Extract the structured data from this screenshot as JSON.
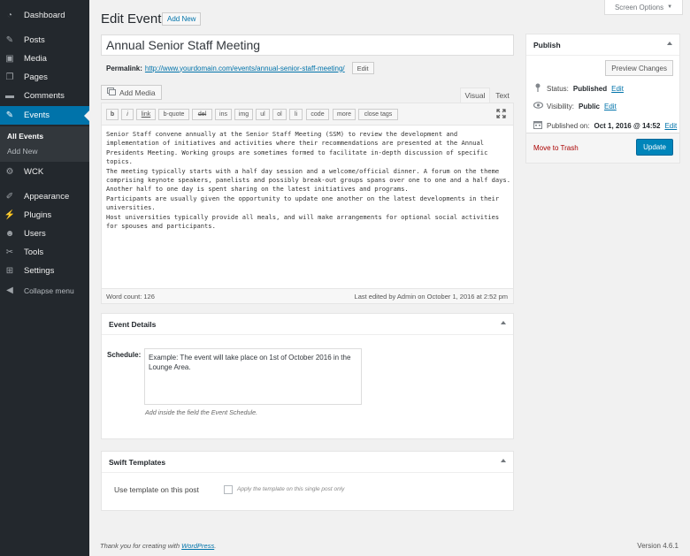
{
  "sidebar": {
    "items": [
      {
        "label": "Dashboard",
        "icon": "dashboard-icon",
        "glyph": "◔"
      },
      {
        "label": "Posts",
        "icon": "pin-icon",
        "glyph": "✎"
      },
      {
        "label": "Media",
        "icon": "media-icon",
        "glyph": "▣"
      },
      {
        "label": "Pages",
        "icon": "pages-icon",
        "glyph": "❐"
      },
      {
        "label": "Comments",
        "icon": "comments-icon",
        "glyph": "▬"
      },
      {
        "label": "Events",
        "icon": "pin-icon",
        "glyph": "✎"
      },
      {
        "label": "WCK",
        "icon": "gear-icon",
        "glyph": "⚙"
      },
      {
        "label": "Appearance",
        "icon": "brush-icon",
        "glyph": "✐"
      },
      {
        "label": "Plugins",
        "icon": "plugin-icon",
        "glyph": "⚡"
      },
      {
        "label": "Users",
        "icon": "user-icon",
        "glyph": "☻"
      },
      {
        "label": "Tools",
        "icon": "wrench-icon",
        "glyph": "✂"
      },
      {
        "label": "Settings",
        "icon": "settings-icon",
        "glyph": "⊞"
      },
      {
        "label": "Collapse menu",
        "icon": "collapse-icon",
        "glyph": "◀"
      }
    ],
    "submenu": [
      "All Events",
      "Add New"
    ]
  },
  "screen_options": {
    "label": "Screen Options",
    "arrow": "▼"
  },
  "header": {
    "title": "Edit Event",
    "add_new": "Add New"
  },
  "post_title": "Annual Senior Staff Meeting",
  "permalink": {
    "label": "Permalink:",
    "url": "http://www.yourdomain.com/events/annual-senior-staff-meeting/",
    "edit": "Edit"
  },
  "editor": {
    "add_media": "Add Media",
    "tabs": {
      "visual": "Visual",
      "text": "Text"
    },
    "quicktags": [
      "b",
      "i",
      "link",
      "b-quote",
      "del",
      "ins",
      "img",
      "ul",
      "ol",
      "li",
      "code",
      "more",
      "close tags"
    ],
    "content": [
      "Senior Staff convene annually at the Senior Staff Meeting (SSM) to review the development and implementation of initiatives and activities where their recommendations are presented at the Annual Presidents Meeting. Working groups are sometimes formed to facilitate in-depth discussion of specific topics.",
      "The meeting typically starts with a half day session and a welcome/official dinner. A forum on the theme comprising keynote speakers, panelists and possibly break-out groups spans over one to one and a half days. Another half to one day is spent sharing on the latest initiatives and programs.",
      "Participants are usually given the opportunity to update one another on the latest developments in their universities.",
      "Host universities typically provide all meals, and will make arrangements for optional social activities for spouses and participants."
    ],
    "word_count": "Word count: 126",
    "last_edited": "Last edited by Admin on October 1, 2016 at 2:52 pm"
  },
  "event_details": {
    "title": "Event Details",
    "schedule_label": "Schedule:",
    "schedule_value": "Example: The event will take place on 1st of October 2016 in the Lounge Area.",
    "schedule_desc": "Add inside the field the Event Schedule."
  },
  "swift_templates": {
    "title": "Swift Templates",
    "label": "Use template on this post",
    "checkbox_desc": "Apply the template on this single post only"
  },
  "publish": {
    "title": "Publish",
    "preview": "Preview Changes",
    "status_label": "Status:",
    "status_value": "Published",
    "visibility_label": "Visibility:",
    "visibility_value": "Public",
    "published_label": "Published on:",
    "published_value": "Oct 1, 2016 @ 14:52",
    "edit": "Edit",
    "trash": "Move to Trash",
    "update": "Update"
  },
  "footer": {
    "thanks_prefix": "Thank you for creating with",
    "wordpress": "WordPress",
    "thanks_suffix": ".",
    "version": "Version 4.6.1"
  },
  "colors": {
    "sidebar": "#23282d",
    "active": "#0073aa",
    "primary_button": "#0085ba",
    "link": "#0073aa",
    "trash": "#a00"
  }
}
